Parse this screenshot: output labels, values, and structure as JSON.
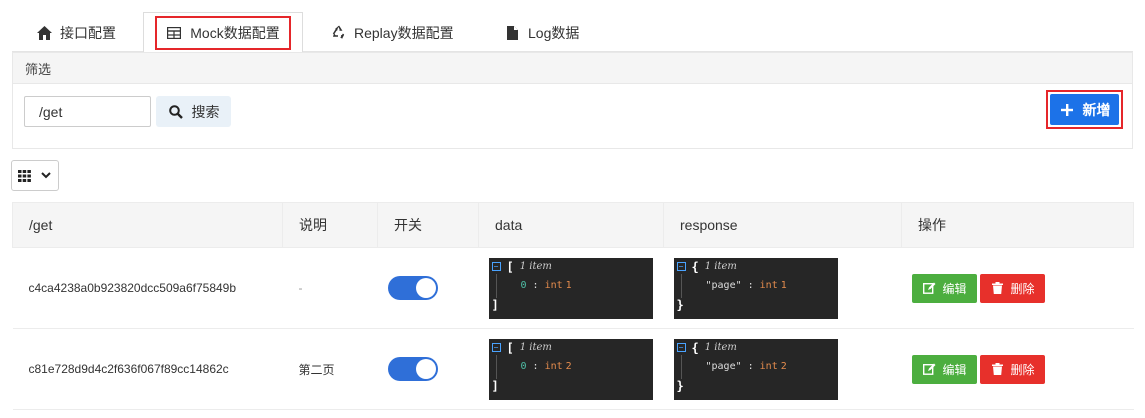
{
  "tabs": [
    {
      "label": "接口配置",
      "icon": "home-icon"
    },
    {
      "label": "Mock数据配置",
      "icon": "table-icon",
      "active": true
    },
    {
      "label": "Replay数据配置",
      "icon": "recycle-icon"
    },
    {
      "label": "Log数据",
      "icon": "file-icon"
    }
  ],
  "filter": {
    "title": "筛选",
    "search_value": "/get",
    "search_label": "搜索",
    "add_label": "新增"
  },
  "table": {
    "headers": [
      "/get",
      "说明",
      "开关",
      "data",
      "response",
      "操作"
    ],
    "rows": [
      {
        "id": "c4ca4238a0b923820dcc509a6f75849b",
        "desc": "-",
        "enabled": true,
        "data": {
          "open": "[",
          "count": "1 item",
          "key": "0",
          "sep": ":",
          "type": "int",
          "value": "1",
          "close": "]"
        },
        "response": {
          "open": "{",
          "count": "1 item",
          "key": "\"page\"",
          "sep": ":",
          "type": "int",
          "value": "1",
          "close": "}"
        },
        "edit_label": "编辑",
        "delete_label": "删除"
      },
      {
        "id": "c81e728d9d4c2f636f067f89cc14862c",
        "desc": "第二页",
        "enabled": true,
        "data": {
          "open": "[",
          "count": "1 item",
          "key": "0",
          "sep": ":",
          "type": "int",
          "value": "2",
          "close": "]"
        },
        "response": {
          "open": "{",
          "count": "1 item",
          "key": "\"page\"",
          "sep": ":",
          "type": "int",
          "value": "2",
          "close": "}"
        },
        "edit_label": "编辑",
        "delete_label": "删除"
      }
    ]
  },
  "colors": {
    "primary": "#1c72e8",
    "edit": "#4cae3f",
    "delete": "#e7302b",
    "highlight": "#e5262a"
  }
}
